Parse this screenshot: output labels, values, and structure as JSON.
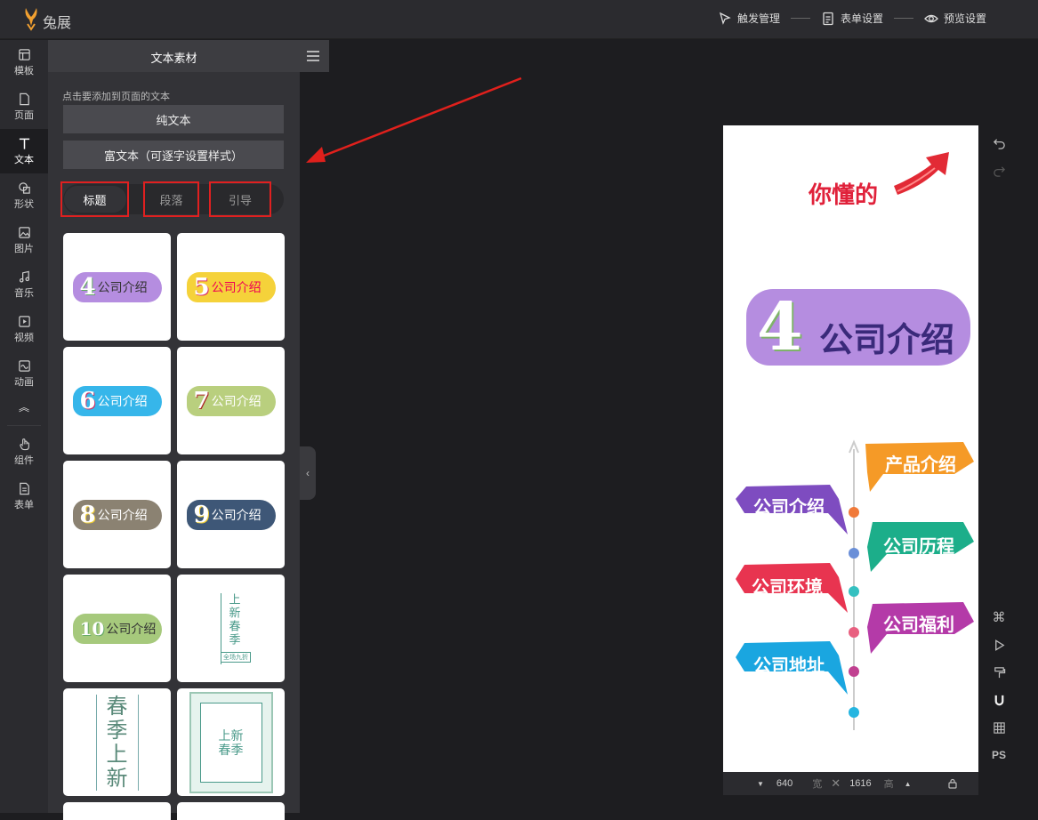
{
  "app": {
    "brand": "兔展"
  },
  "topbar": {
    "actions": [
      {
        "label": "触发管理",
        "icon": "cursor-icon"
      },
      {
        "label": "表单设置",
        "icon": "form-doc-icon"
      },
      {
        "label": "预览设置",
        "icon": "eye-icon"
      }
    ]
  },
  "leftnav": {
    "items": [
      {
        "label": "模板",
        "icon": "template-icon"
      },
      {
        "label": "页面",
        "icon": "page-icon"
      },
      {
        "label": "文本",
        "icon": "text-icon"
      },
      {
        "label": "形状",
        "icon": "shape-icon"
      },
      {
        "label": "图片",
        "icon": "image-icon"
      },
      {
        "label": "音乐",
        "icon": "music-icon"
      },
      {
        "label": "视频",
        "icon": "video-icon"
      },
      {
        "label": "动画",
        "icon": "animation-icon"
      },
      {
        "label": "组件",
        "icon": "component-icon"
      },
      {
        "label": "表单",
        "icon": "form-icon"
      }
    ],
    "active": "文本"
  },
  "panel": {
    "title": "文本素材",
    "hint": "点击要添加到页面的文本",
    "plain_text_button": "纯文本",
    "rich_text_button": "富文本（可逐字设置样式）",
    "tabs": [
      "标题",
      "段落",
      "引导"
    ],
    "active_tab": "标题",
    "cards": [
      {
        "num": "4",
        "text": "公司介绍",
        "color": "#b58de0"
      },
      {
        "num": "5",
        "text": "公司介绍",
        "color": "#f5d23a"
      },
      {
        "num": "6",
        "text": "公司介绍",
        "color": "#36b6ea"
      },
      {
        "num": "7",
        "text": "公司介绍",
        "color": "#b9cf7e"
      },
      {
        "num": "8",
        "text": "公司介绍",
        "color": "#8b8272"
      },
      {
        "num": "9",
        "text": "公司介绍",
        "color": "#3e5777"
      },
      {
        "num": "10",
        "text": "公司介绍",
        "color": "#a6c97c"
      },
      {
        "text": "上新春季",
        "sub": "全场九折"
      },
      {
        "text": "春季上新"
      },
      {
        "text": "上新春季"
      }
    ]
  },
  "canvas": {
    "headline": "你懂的",
    "title_num": "4",
    "title_text": "公司介绍",
    "timeline": [
      "产品介绍",
      "公司介绍",
      "公司历程",
      "公司环境",
      "公司福利",
      "公司地址"
    ],
    "width": "640",
    "width_unit": "宽",
    "height": "1616",
    "height_unit": "高"
  },
  "righttools": [
    "undo-icon",
    "redo-icon",
    "command-icon",
    "play-icon",
    "format-painter-icon",
    "magnet-icon",
    "grid-icon",
    "PS"
  ]
}
